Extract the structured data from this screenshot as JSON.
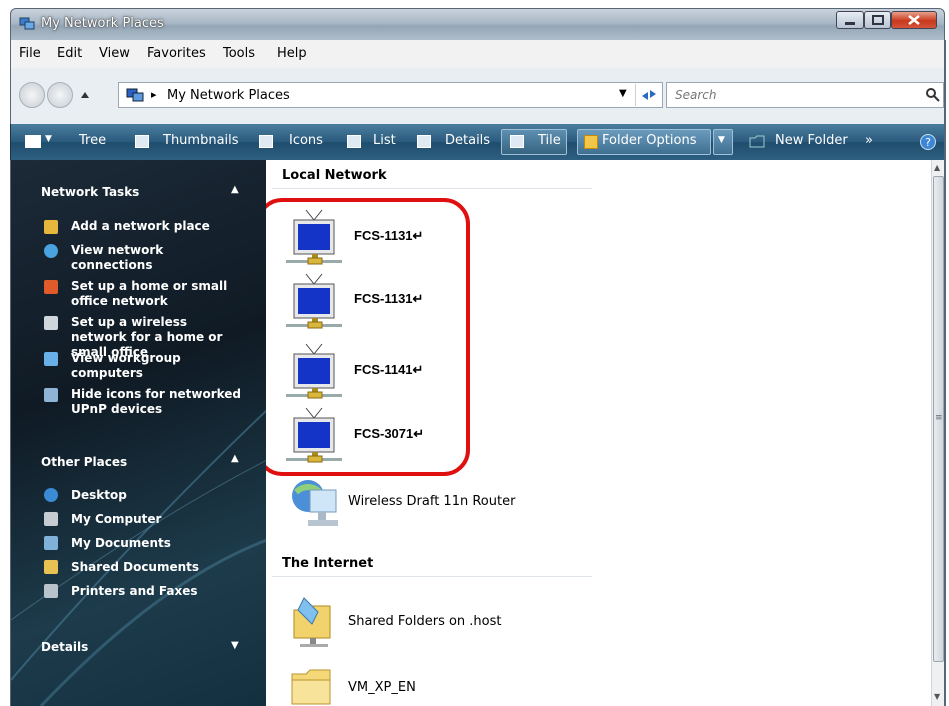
{
  "window": {
    "title": "My Network Places"
  },
  "menu": [
    "File",
    "Edit",
    "View",
    "Favorites",
    "Tools",
    "Help"
  ],
  "address": {
    "path": "My Network Places",
    "search_placeholder": "Search"
  },
  "toolbar": {
    "items": [
      "Tree",
      "Thumbnails",
      "Icons",
      "List",
      "Details",
      "Tile"
    ],
    "folder_options": "Folder Options",
    "new_folder": "New Folder",
    "more": "»"
  },
  "left_pane": {
    "network_tasks": {
      "title": "Network Tasks",
      "items": [
        "Add a network place",
        "View network connections",
        "Set up a home or small office network",
        "Set up a wireless network for a home or small office",
        "View workgroup computers",
        "Hide icons for networked UPnP devices"
      ]
    },
    "other_places": {
      "title": "Other Places",
      "items": [
        "Desktop",
        "My Computer",
        "My Documents",
        "Shared Documents",
        "Printers and Faxes"
      ]
    },
    "details": {
      "title": "Details"
    }
  },
  "content": {
    "local_network": {
      "title": "Local Network",
      "devices": [
        "FCS-1131↵",
        "FCS-1131↵",
        "FCS-1141↵",
        "FCS-3071↵"
      ],
      "router": "Wireless Draft 11n Router"
    },
    "internet": {
      "title": "The Internet",
      "items": [
        "Shared Folders on .host",
        "VM_XP_EN"
      ]
    }
  },
  "colors": {
    "highlight": "#e01010",
    "toolbar": "#2a5a7d",
    "left_pane": "#0f1a24"
  }
}
